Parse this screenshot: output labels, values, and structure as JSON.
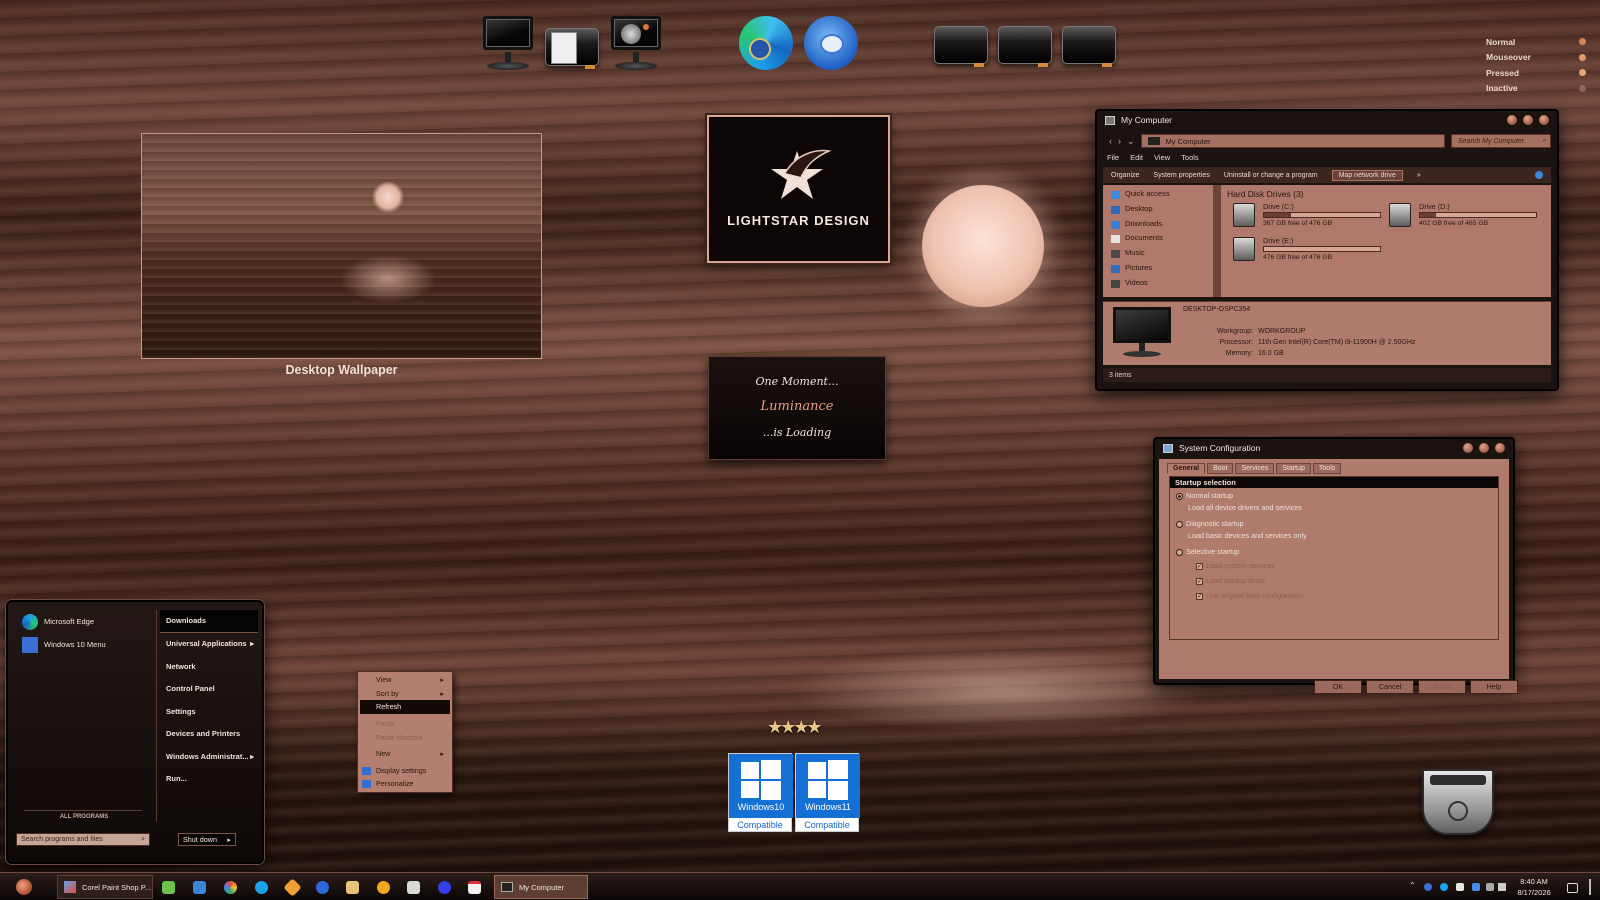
{
  "state_legend": {
    "items": [
      {
        "label": "Normal",
        "color": "#d7844f"
      },
      {
        "label": "Mouseover",
        "color": "#e39a64"
      },
      {
        "label": "Pressed",
        "color": "#e8a777"
      },
      {
        "label": "Inactive",
        "color": "#8f6658"
      }
    ]
  },
  "desktop": {
    "wallpaper_caption": "Desktop Wallpaper",
    "logo_text": "LIGHTSTAR DESIGN",
    "loading": {
      "line1": "One Moment...",
      "line2": "Luminance",
      "line3": "...is Loading"
    },
    "badges": {
      "win10": "Windows10",
      "win11": "Windows11",
      "compatible": "Compatible"
    }
  },
  "my_computer": {
    "title": "My Computer",
    "address": "My Computer",
    "search_placeholder": "Search My Computer",
    "menu": [
      "File",
      "Edit",
      "View",
      "Tools"
    ],
    "toolbar": {
      "organize": "Organize",
      "system_properties": "System properties",
      "uninstall": "Uninstall or change a program",
      "map_drive": "Map network drive",
      "more": "»"
    },
    "nav": [
      "Quick access",
      "Desktop",
      "Downloads",
      "Documents",
      "Music",
      "Pictures",
      "Videos"
    ],
    "group_header": "Hard Disk Drives (3)",
    "drives": [
      {
        "name": "Drive (C:)",
        "free": "367 GB free of 476 GB",
        "used_fraction": 0.23
      },
      {
        "name": "Drive (D:)",
        "free": "402 GB free of 465 GB",
        "used_fraction": 0.14
      },
      {
        "name": "Drive (E:)",
        "free": "476 GB free of 476 GB",
        "used_fraction": 0.0
      }
    ],
    "details": {
      "computer_name": "DESKTOP-OSPC354",
      "workgroup_label": "Workgroup:",
      "workgroup": "WORKGROUP",
      "processor_label": "Processor:",
      "processor": "11th Gen Intel(R) Core(TM) i9-11900H @ 2.50GHz",
      "memory_label": "Memory:",
      "memory": "16.0 GB"
    },
    "status": "3 items"
  },
  "sysconfig": {
    "title": "System Configuration",
    "tabs": [
      "General",
      "Boot",
      "Services",
      "Startup",
      "Tools"
    ],
    "group_title": "Startup selection",
    "normal": "Normal startup",
    "normal_desc": "Load all device drivers and services",
    "diagnostic": "Diagnostic startup",
    "diagnostic_desc": "Load basic devices and services only",
    "selective": "Selective startup",
    "checks": [
      "Load system services",
      "Load startup items",
      "Use original boot configuration"
    ],
    "buttons": {
      "ok": "OK",
      "cancel": "Cancel",
      "apply": "Apply",
      "help": "Help"
    }
  },
  "start_menu": {
    "pinned": [
      {
        "label": "Microsoft Edge",
        "icon": "edge-icon"
      },
      {
        "label": "Windows 10 Menu",
        "icon": "menu-icon"
      }
    ],
    "all_programs": "ALL PROGRAMS",
    "right": [
      {
        "label": "Downloads",
        "arrow": ""
      },
      {
        "label": "Universal Applications",
        "arrow": "▸"
      },
      {
        "label": "Network",
        "arrow": ""
      },
      {
        "label": "Control Panel",
        "arrow": ""
      },
      {
        "label": "Settings",
        "arrow": ""
      },
      {
        "label": "Devices and Printers",
        "arrow": ""
      },
      {
        "label": "Windows Administrat...",
        "arrow": "▸"
      },
      {
        "label": "Run...",
        "arrow": ""
      }
    ],
    "search_placeholder": "Search programs and files",
    "shutdown": "Shut down"
  },
  "context_menu": {
    "items": [
      {
        "label": "View",
        "arrow": "▸",
        "state": ""
      },
      {
        "label": "Sort by",
        "arrow": "▸",
        "state": ""
      },
      {
        "label": "Refresh",
        "arrow": "",
        "state": "hl"
      },
      {
        "label": "Paste",
        "arrow": "",
        "state": "dis"
      },
      {
        "label": "Paste shortcut",
        "arrow": "",
        "state": "dis"
      },
      {
        "label": "New",
        "arrow": "▸",
        "state": ""
      },
      {
        "label": "Display settings",
        "arrow": "",
        "state": "icon"
      },
      {
        "label": "Personalize",
        "arrow": "",
        "state": "icon"
      }
    ]
  },
  "taskbar": {
    "tasks": [
      {
        "label": "Corel Paint Shop P..."
      },
      {
        "label": "My Computer"
      }
    ],
    "time": "8:40 AM",
    "date": "8/17/2026"
  }
}
